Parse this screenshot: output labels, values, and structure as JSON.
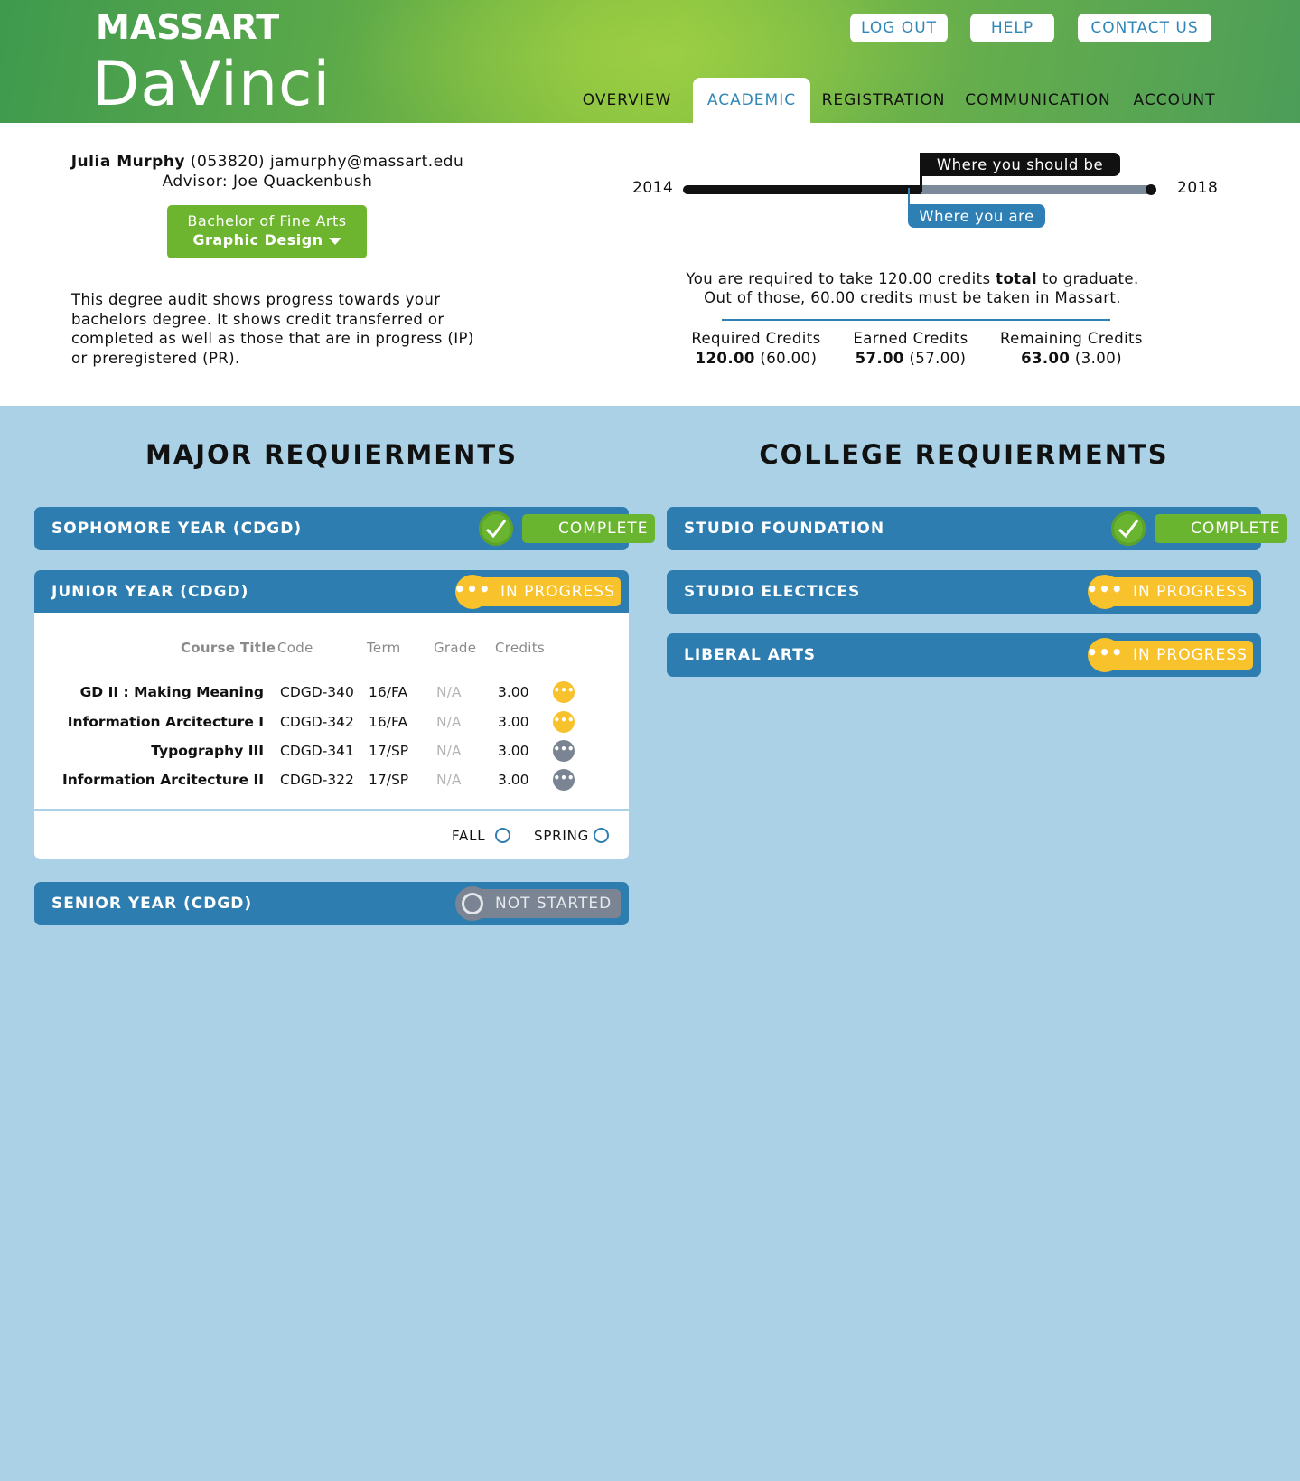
{
  "header": {
    "brand": "MASSART",
    "app_name": "DaVinci",
    "top_buttons": {
      "logout": "LOG OUT",
      "help": "HELP",
      "contact": "CONTACT US"
    },
    "nav": [
      "OVERVIEW",
      "ACADEMIC",
      "REGISTRATION",
      "COMMUNICATION",
      "ACCOUNT"
    ],
    "active_tab": "ACADEMIC"
  },
  "student": {
    "name": "Julia Murphy",
    "id": "(053820)",
    "email": "jamurphy@massart.edu",
    "advisor": "Advisor: Joe Quackenbush",
    "degree": "Bachelor of Fine Arts",
    "major": "Graphic Design",
    "description": "This degree audit shows progress towards your bachelors degree. It shows credit transferred or completed as well as those that are in progress (IP) or preregistered (PR)."
  },
  "timeline": {
    "start_year": "2014",
    "end_year": "2018",
    "should_be_label": "Where you should be",
    "you_are_label": "Where you are",
    "should_be_progress": 0.51,
    "you_are_progress": 0.48
  },
  "credits": {
    "req_line1_a": "You are required to take 120.00 credits ",
    "req_line1_bold": "total",
    "req_line1_b": " to graduate.",
    "req_line2": "Out of those, 60.00 credits must be taken in Massart.",
    "required": {
      "label": "Required Credits",
      "value": "120.00",
      "sub": "(60.00)"
    },
    "earned": {
      "label": "Earned Credits",
      "value": "57.00",
      "sub": "(57.00)"
    },
    "remaining": {
      "label": "Remaining Credits",
      "value": "63.00",
      "sub": "(3.00)"
    }
  },
  "major": {
    "title": "MAJOR REQUIERMENTS",
    "sections": [
      {
        "name": "SOPHOMORE YEAR (CDGD)",
        "status": "COMPLETE"
      },
      {
        "name": "JUNIOR YEAR (CDGD)",
        "status": "IN PROGRESS"
      },
      {
        "name": "SENIOR YEAR (CDGD)",
        "status": "NOT STARTED"
      }
    ],
    "table_headers": {
      "title": "Course Title",
      "code": "Code",
      "term": "Term",
      "grade": "Grade",
      "credits": "Credits"
    },
    "courses": [
      {
        "title": "GD II : Making Meaning",
        "code": "CDGD-340",
        "term": "16/FA",
        "grade": "N/A",
        "credits": "3.00",
        "state": "in-progress"
      },
      {
        "title": "Information Arcitecture I",
        "code": "CDGD-342",
        "term": "16/FA",
        "grade": "N/A",
        "credits": "3.00",
        "state": "in-progress"
      },
      {
        "title": "Typography III",
        "code": "CDGD-341",
        "term": "17/SP",
        "grade": "N/A",
        "credits": "3.00",
        "state": "preregistered"
      },
      {
        "title": "Information Arcitecture II",
        "code": "CDGD-322",
        "term": "17/SP",
        "grade": "N/A",
        "credits": "3.00",
        "state": "preregistered"
      }
    ],
    "filters": {
      "fall": "FALL",
      "spring": "SPRING"
    }
  },
  "college": {
    "title": "COLLEGE REQUIERMENTS",
    "sections": [
      {
        "name": "STUDIO FOUNDATION",
        "status": "COMPLETE"
      },
      {
        "name": "STUDIO ELECTICES",
        "status": "IN PROGRESS"
      },
      {
        "name": "LIBERAL ARTS",
        "status": "IN PROGRESS"
      }
    ]
  },
  "colors": {
    "primary_blue": "#2e7db0",
    "complete_green": "#6ab52f",
    "progress_yellow": "#f7c22b",
    "not_started_grey": "#7a8492",
    "page_bg": "#abd1e6"
  },
  "icons": {
    "complete": "checkmark-icon",
    "in_progress": "more-dots-icon",
    "not_started": "empty-circle-icon",
    "degree_menu": "caret-down-icon"
  }
}
